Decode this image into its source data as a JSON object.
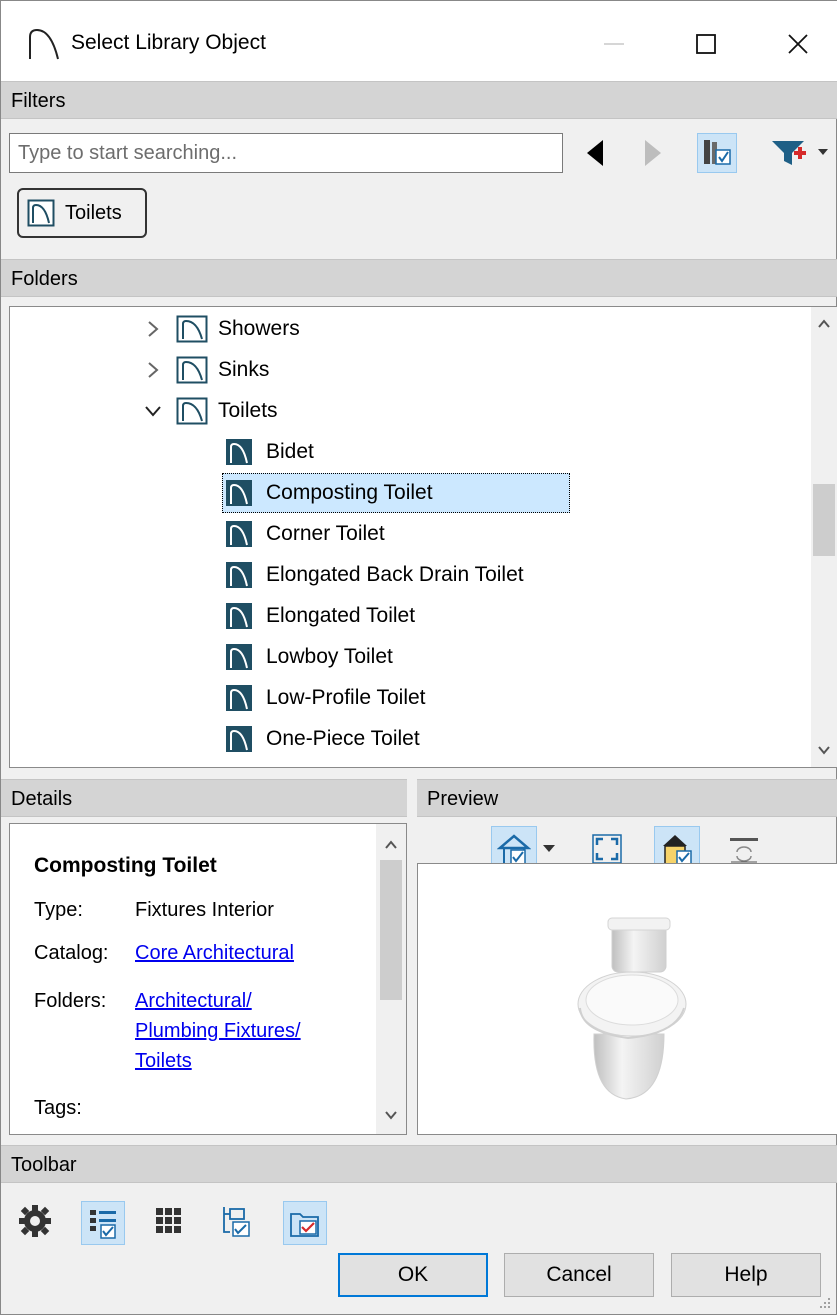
{
  "window": {
    "title": "Select Library Object",
    "minimize_label": "—",
    "maximize_icon": "square-icon",
    "close_label": "✕"
  },
  "filters": {
    "header": "Filters",
    "search_placeholder": "Type to start searching...",
    "active_filter": "Toilets"
  },
  "folders": {
    "header": "Folders",
    "items": [
      {
        "label": "Showers",
        "type": "folder",
        "expanded": false
      },
      {
        "label": "Sinks",
        "type": "folder",
        "expanded": false
      },
      {
        "label": "Toilets",
        "type": "folder",
        "expanded": true
      },
      {
        "label": "Bidet",
        "type": "object"
      },
      {
        "label": "Composting Toilet",
        "type": "object",
        "selected": true
      },
      {
        "label": "Corner Toilet",
        "type": "object"
      },
      {
        "label": "Elongated Back Drain Toilet",
        "type": "object"
      },
      {
        "label": "Elongated Toilet",
        "type": "object"
      },
      {
        "label": "Lowboy Toilet",
        "type": "object"
      },
      {
        "label": "Low-Profile Toilet",
        "type": "object"
      },
      {
        "label": "One-Piece Toilet",
        "type": "object"
      }
    ]
  },
  "details": {
    "header": "Details",
    "name": "Composting Toilet",
    "type_label": "Type:",
    "type_value": "Fixtures Interior",
    "catalog_label": "Catalog:",
    "catalog_value": "Core Architectural",
    "folders_label": "Folders:",
    "folders_line1": "Architectural/",
    "folders_line2": "Plumbing Fixtures/",
    "folders_line3": "Toilets",
    "tags_label": "Tags:"
  },
  "preview": {
    "header": "Preview"
  },
  "toolbar": {
    "header": "Toolbar"
  },
  "buttons": {
    "ok": "OK",
    "cancel": "Cancel",
    "help": "Help"
  },
  "colors": {
    "accent": "#0078d7",
    "selection": "#cce8ff",
    "link": "#0000ee",
    "icon_teal": "#1f4e63"
  }
}
